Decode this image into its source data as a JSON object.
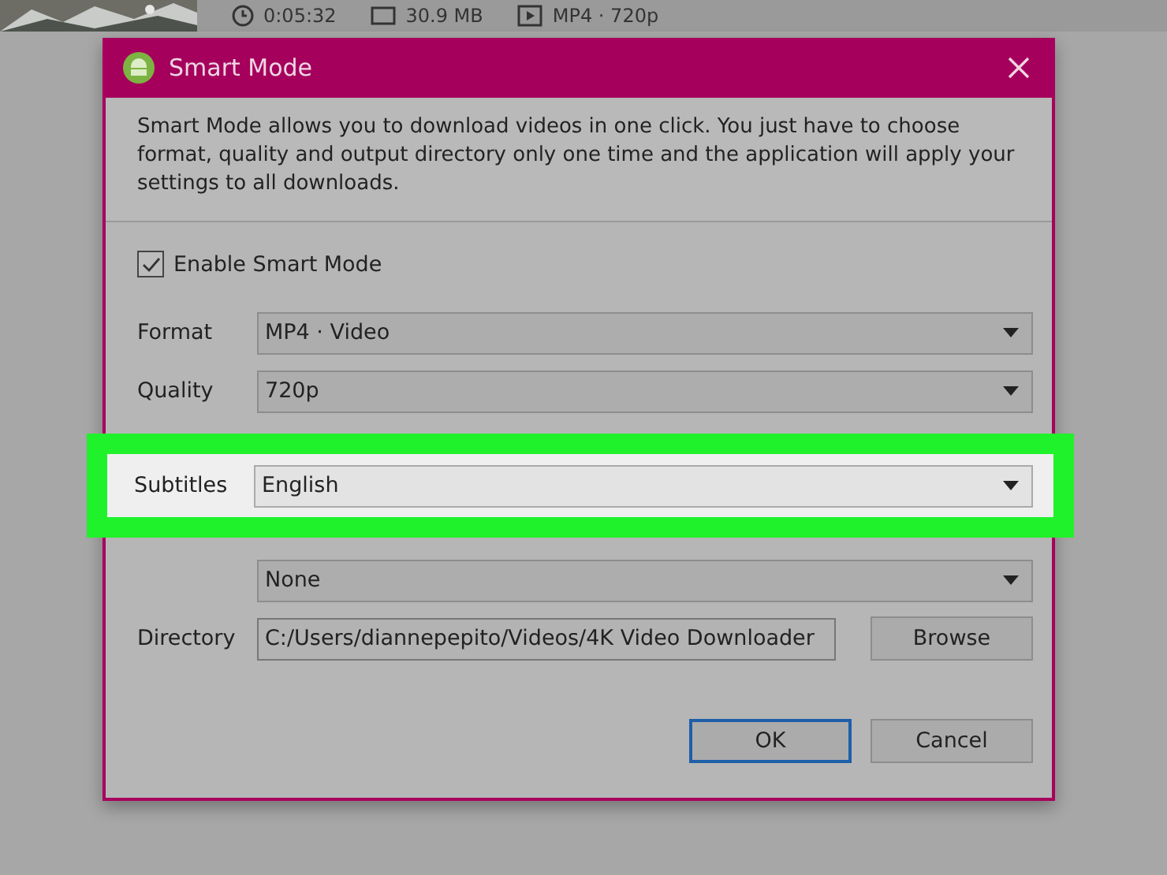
{
  "background_app": {
    "info": [
      {
        "kind": "clock",
        "text": "0:05:32"
      },
      {
        "kind": "size",
        "text": "30.9 MB"
      },
      {
        "kind": "play",
        "text": "MP4 · 720p"
      }
    ]
  },
  "dialog": {
    "title": "Smart Mode",
    "description": "Smart Mode allows you to download videos in one click. You just have to choose format, quality and output directory only one time and the application will apply your settings to all downloads.",
    "enable": {
      "label": "Enable Smart Mode",
      "checked": true
    },
    "fields": [
      {
        "label": "Format",
        "value": "MP4 · Video",
        "highlighted": false
      },
      {
        "label": "Quality",
        "value": "720p",
        "highlighted": false
      },
      {
        "label": "Subtitles",
        "value": "English",
        "highlighted": true
      },
      {
        "value": "None",
        "highlighted": false
      }
    ],
    "directory": {
      "label": "Directory",
      "value": "C:/Users/diannepepito/Videos/4K Video Downloader",
      "button": "Browse"
    },
    "buttons": [
      {
        "label": "OK",
        "default": true
      },
      {
        "label": "Cancel",
        "default": false
      }
    ]
  }
}
